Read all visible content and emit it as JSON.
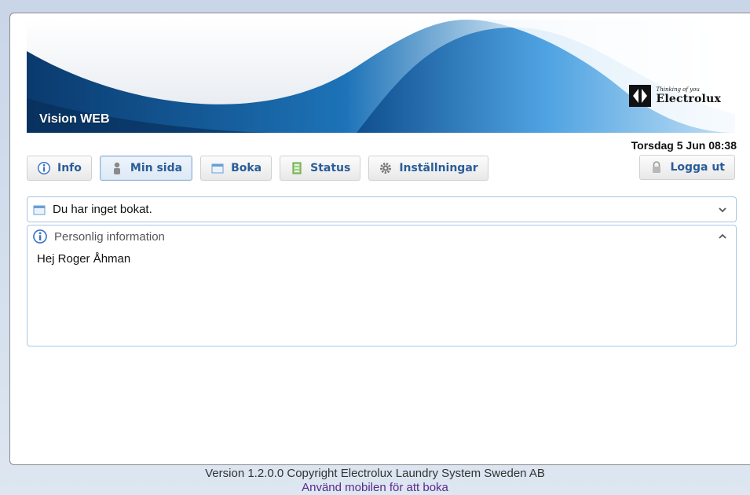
{
  "header": {
    "app_title": "Vision WEB",
    "brand_tagline": "Thinking of you",
    "brand_name": "Electrolux"
  },
  "datetime": "Torsdag 5 Jun 08:38",
  "nav": {
    "items": [
      {
        "label": "Info",
        "icon": "info-icon",
        "active": false
      },
      {
        "label": "Min sida",
        "icon": "user-icon",
        "active": true
      },
      {
        "label": "Boka",
        "icon": "calendar-icon",
        "active": false
      },
      {
        "label": "Status",
        "icon": "status-icon",
        "active": false
      },
      {
        "label": "Inställningar",
        "icon": "gear-icon",
        "active": false
      }
    ],
    "logout_label": "Logga ut"
  },
  "booking_panel": {
    "text": "Du har inget bokat.",
    "icon": "calendar-icon",
    "state": "collapsed"
  },
  "info_panel": {
    "title": "Personlig information",
    "greeting": "Hej Roger Åhman",
    "icon": "info-icon",
    "state": "expanded"
  },
  "footer": {
    "version": "Version 1.2.0.0 Copyright Electrolux Laundry System Sweden AB",
    "mobile_link": "Använd mobilen för att boka"
  },
  "colors": {
    "button_text": "#2a5d98",
    "panel_border": "#a8c6e4",
    "link": "#5a2a8a"
  }
}
